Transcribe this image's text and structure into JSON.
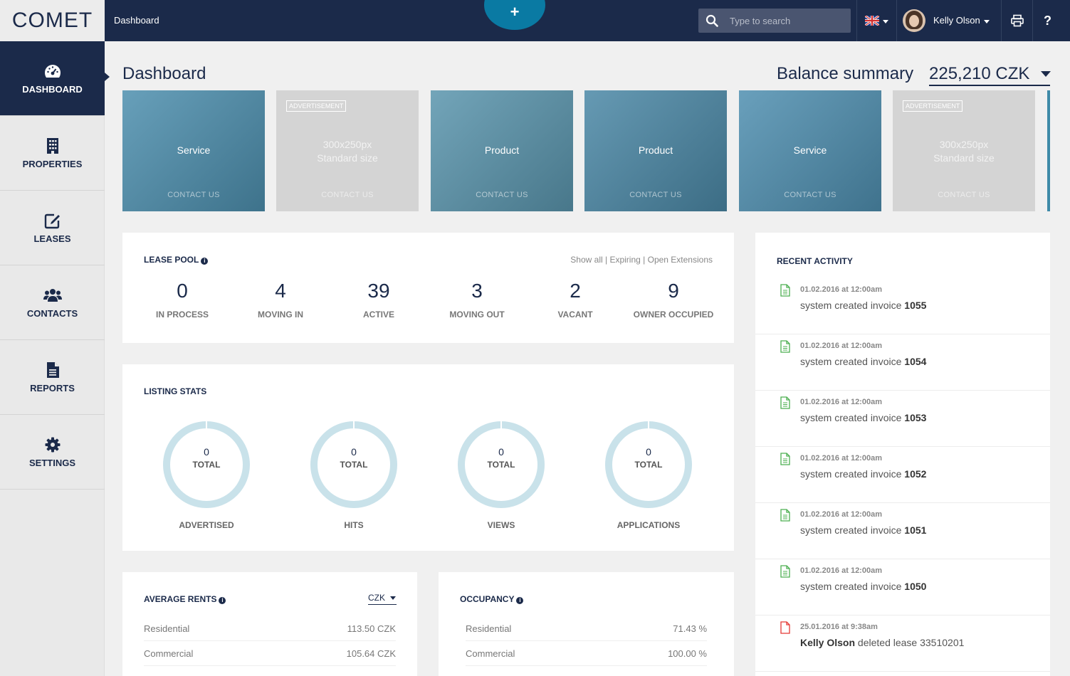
{
  "app": {
    "logo_text": "COMET",
    "top_title": "Dashboard",
    "add_label": "+",
    "search_placeholder": "Type to search",
    "user_name": "Kelly Olson",
    "help_label": "?"
  },
  "sidebar": {
    "items": [
      {
        "label": "DASHBOARD",
        "icon": "dashboard-icon",
        "active": true
      },
      {
        "label": "PROPERTIES",
        "icon": "building-icon",
        "active": false
      },
      {
        "label": "LEASES",
        "icon": "edit-icon",
        "active": false
      },
      {
        "label": "CONTACTS",
        "icon": "users-icon",
        "active": false
      },
      {
        "label": "REPORTS",
        "icon": "document-icon",
        "active": false
      },
      {
        "label": "SETTINGS",
        "icon": "gear-icon",
        "active": false
      }
    ]
  },
  "header": {
    "title": "Dashboard",
    "balance_label": "Balance summary",
    "balance_value": "225,210 CZK"
  },
  "ads": [
    {
      "kind": "photo",
      "title": "Service",
      "contact": "CONTACT US",
      "color": "#4d8fae"
    },
    {
      "kind": "placeholder",
      "tag": "ADVERTISEMENT",
      "line1": "300x250px",
      "line2": "Standard size",
      "contact": "CONTACT US"
    },
    {
      "kind": "photo",
      "title": "Product",
      "contact": "CONTACT US",
      "color": "#5a95ad"
    },
    {
      "kind": "photo",
      "title": "Product",
      "contact": "CONTACT US",
      "color": "#4b88a6"
    },
    {
      "kind": "photo",
      "title": "Service",
      "contact": "CONTACT US",
      "color": "#4f8fb0"
    },
    {
      "kind": "placeholder",
      "tag": "ADVERTISEMENT",
      "line1": "300x250px",
      "line2": "Standard size",
      "contact": "CONTACT US"
    }
  ],
  "lease_pool": {
    "title": "LEASE POOL",
    "links": [
      "Show all",
      "Expiring",
      "Open Extensions"
    ],
    "stats": [
      {
        "value": "0",
        "label": "IN PROCESS"
      },
      {
        "value": "4",
        "label": "MOVING IN"
      },
      {
        "value": "39",
        "label": "ACTIVE"
      },
      {
        "value": "3",
        "label": "MOVING OUT"
      },
      {
        "value": "2",
        "label": "VACANT"
      },
      {
        "value": "9",
        "label": "OWNER OCCUPIED"
      }
    ]
  },
  "listing_stats": {
    "title": "LISTING STATS",
    "donuts": [
      {
        "value": "0",
        "unit": "TOTAL",
        "label": "ADVERTISED"
      },
      {
        "value": "0",
        "unit": "TOTAL",
        "label": "HITS"
      },
      {
        "value": "0",
        "unit": "TOTAL",
        "label": "VIEWS"
      },
      {
        "value": "0",
        "unit": "TOTAL",
        "label": "APPLICATIONS"
      }
    ]
  },
  "average_rents": {
    "title": "AVERAGE RENTS",
    "currency": "CZK",
    "rows": [
      {
        "label": "Residential",
        "value": "113.50 CZK"
      },
      {
        "label": "Commercial",
        "value": "105.64 CZK"
      }
    ]
  },
  "occupancy": {
    "title": "OCCUPANCY",
    "rows": [
      {
        "label": "Residential",
        "value": "71.43 %"
      },
      {
        "label": "Commercial",
        "value": "100.00 %"
      }
    ]
  },
  "recent_activity": {
    "title": "RECENT ACTIVITY",
    "items": [
      {
        "when": "01.02.2016 at 12:00am",
        "pre": "system created invoice ",
        "strong": "1055",
        "post": "",
        "kind": "invoice"
      },
      {
        "when": "01.02.2016 at 12:00am",
        "pre": "system created invoice ",
        "strong": "1054",
        "post": "",
        "kind": "invoice"
      },
      {
        "when": "01.02.2016 at 12:00am",
        "pre": "system created invoice ",
        "strong": "1053",
        "post": "",
        "kind": "invoice"
      },
      {
        "when": "01.02.2016 at 12:00am",
        "pre": "system created invoice ",
        "strong": "1052",
        "post": "",
        "kind": "invoice"
      },
      {
        "when": "01.02.2016 at 12:00am",
        "pre": "system created invoice ",
        "strong": "1051",
        "post": "",
        "kind": "invoice"
      },
      {
        "when": "01.02.2016 at 12:00am",
        "pre": "system created invoice ",
        "strong": "1050",
        "post": "",
        "kind": "invoice"
      },
      {
        "when": "25.01.2016 at 9:38am",
        "pre": "",
        "strong": "Kelly Olson",
        "post": " deleted lease 33510201",
        "kind": "delete"
      }
    ]
  },
  "colors": {
    "navy": "#1b2a4a",
    "accent": "#0a7aa3",
    "donut": "#c9e2ea",
    "invoice_icon": "#4caf50",
    "delete_icon": "#e53935"
  }
}
